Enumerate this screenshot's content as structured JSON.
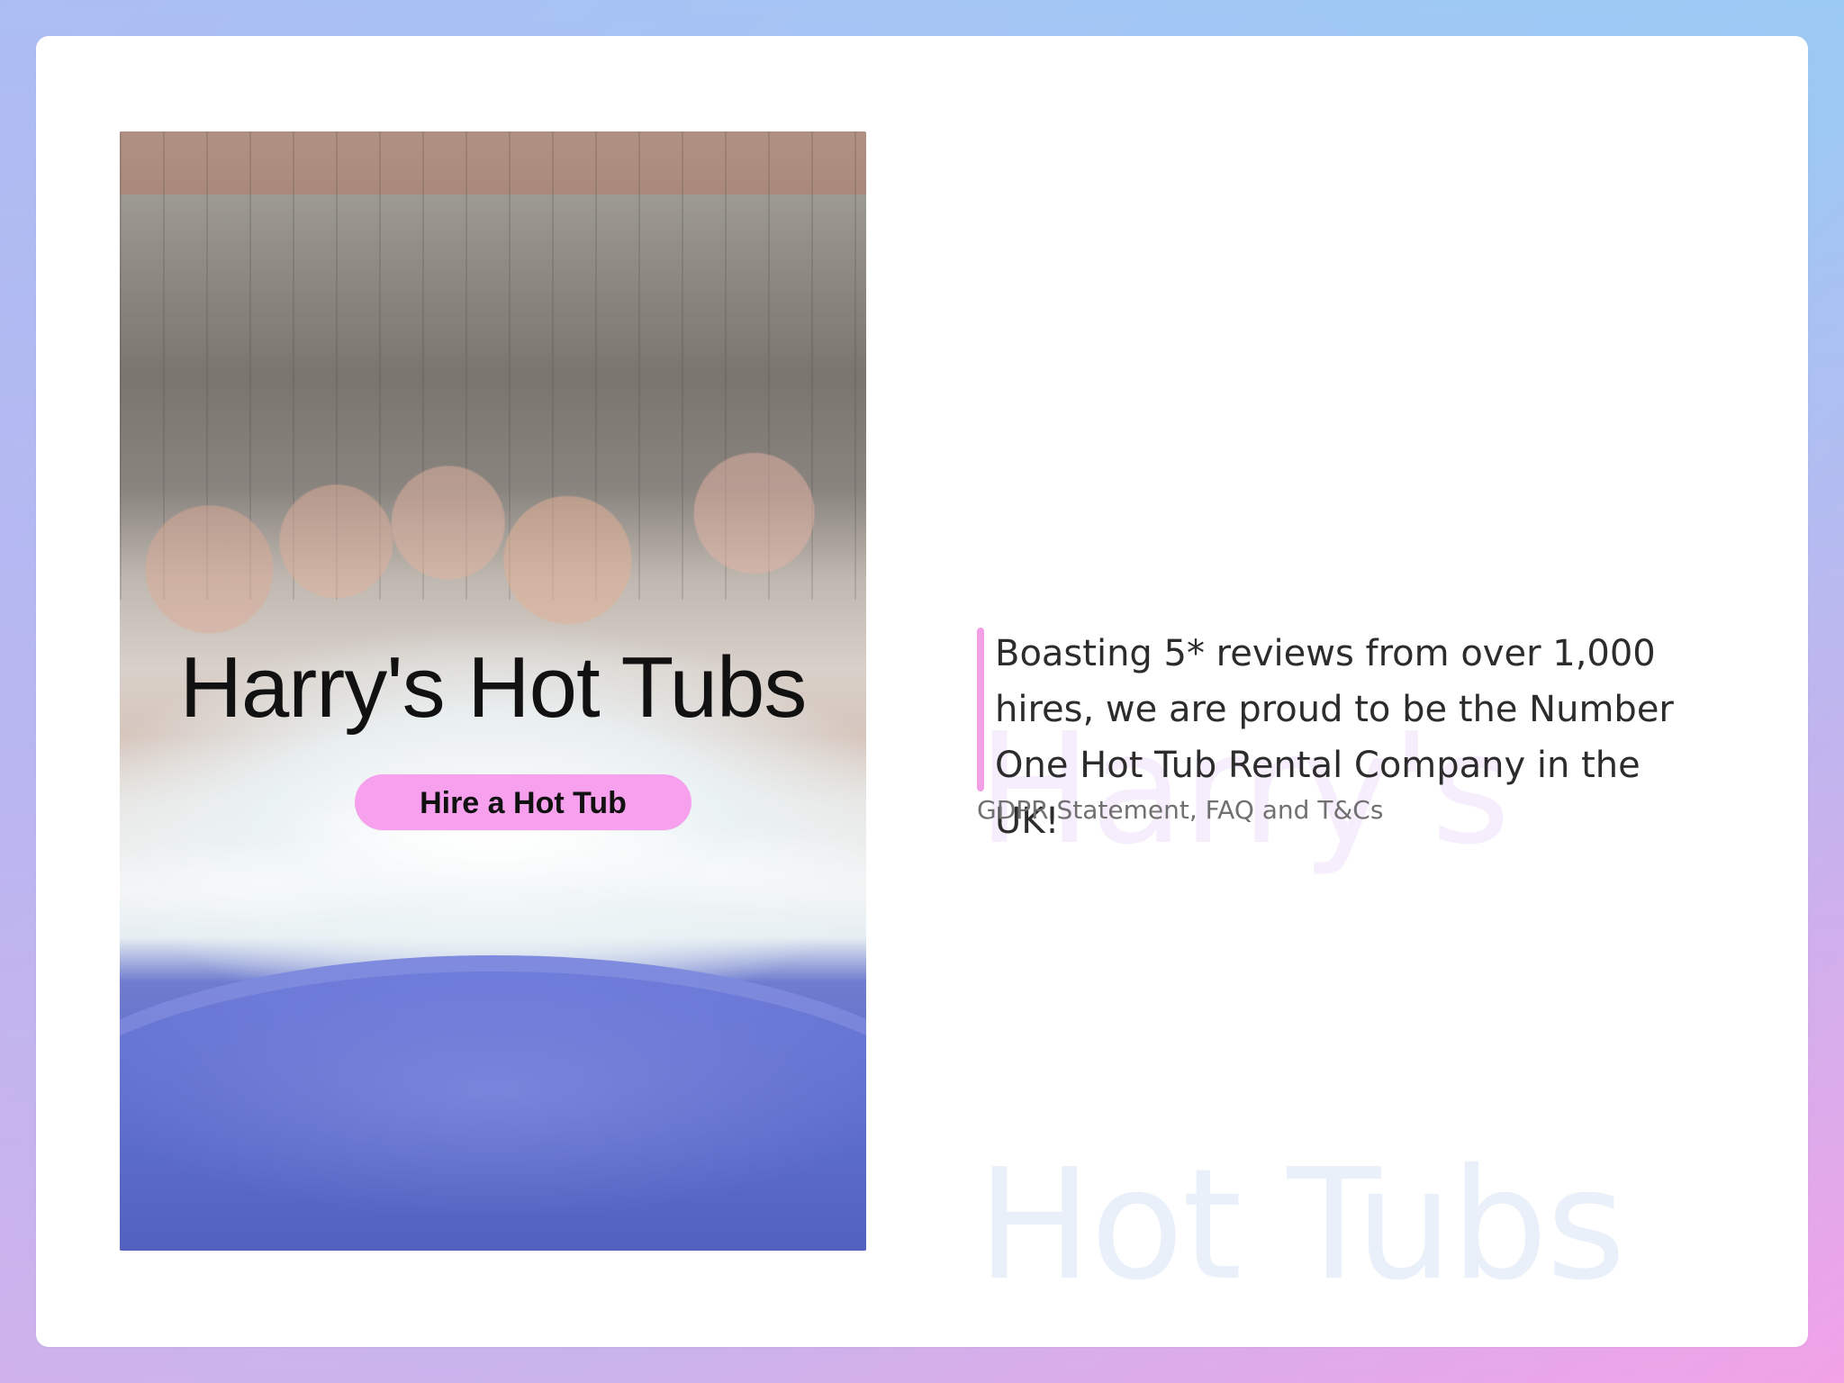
{
  "hero": {
    "title": "Harry's Hot Tubs",
    "cta_label": "Hire a Hot Tub"
  },
  "right": {
    "watermark_line1": "Harry's",
    "watermark_line2": "Hot Tubs",
    "quote": "Boasting 5* reviews from over 1,000 hires, we are proud to be the Number One Hot Tub Rental Company in the UK!",
    "legal_link": "GDPR Statement, FAQ and T&Cs"
  },
  "colors": {
    "accent_pink": "#f7a1ee",
    "text_dark": "#111111",
    "muted": "#707070"
  }
}
